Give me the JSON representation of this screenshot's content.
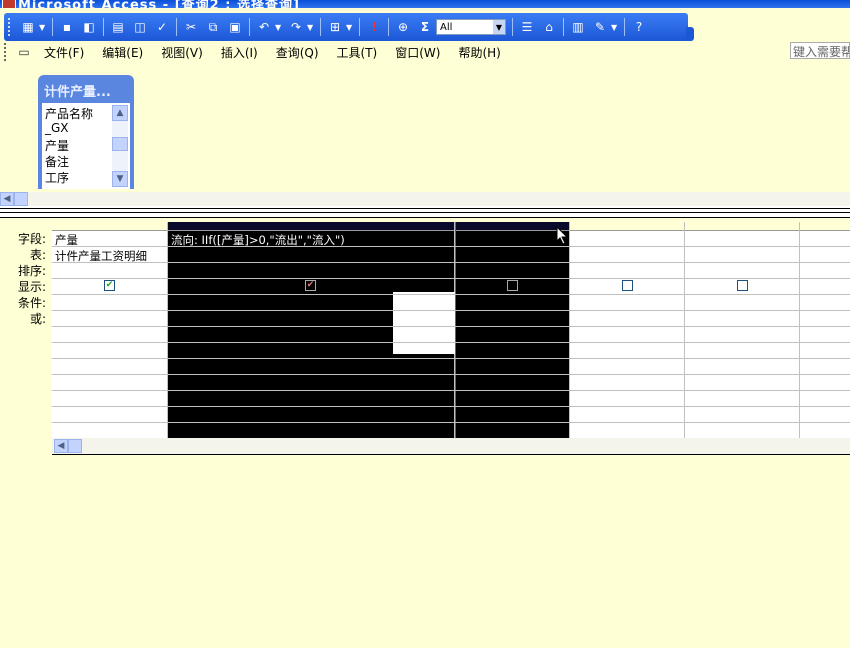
{
  "window": {
    "title": "Microsoft Access - [查询2 : 选择查询]"
  },
  "toolbar": {
    "zoom_value": "All",
    "sigma": "Σ"
  },
  "menu": {
    "items": [
      "文件(F)",
      "编辑(E)",
      "视图(V)",
      "插入(I)",
      "查询(Q)",
      "工具(T)",
      "窗口(W)",
      "帮助(H)"
    ],
    "help_placeholder": "键入需要帮"
  },
  "field_list": {
    "title": "计件产量...",
    "items": [
      "产品名称",
      "_GX",
      "产量",
      "备注",
      "工序"
    ]
  },
  "grid": {
    "row_labels": [
      "字段:",
      "表:",
      "排序:",
      "显示:",
      "条件:",
      "或:"
    ],
    "columns": [
      {
        "field": "产量",
        "table": "计件产量工资明细",
        "show": true
      },
      {
        "field": "流向: IIf([产量]>0,\"流出\",\"流入\")",
        "table": "",
        "show": true
      },
      {
        "field": "",
        "table": "",
        "show": false
      },
      {
        "field": "",
        "table": "",
        "show": false
      },
      {
        "field": "",
        "table": "",
        "show": false
      }
    ]
  },
  "colors": {
    "background": "#ffffd5",
    "toolbar_blue": "#1c57d6",
    "selected_column": "#000000"
  }
}
